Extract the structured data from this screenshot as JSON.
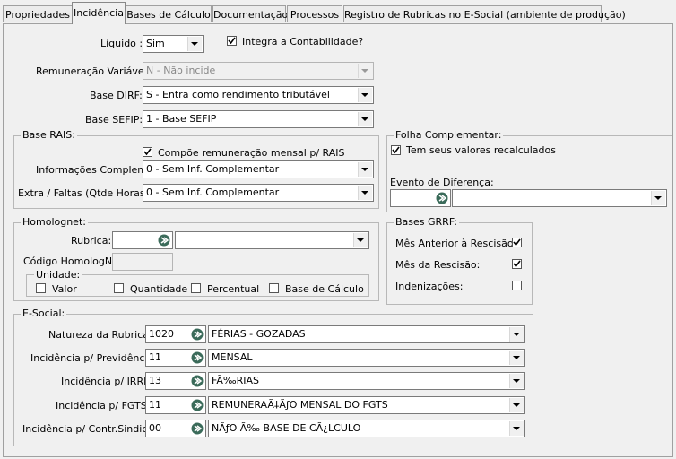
{
  "tabs": [
    "Propriedades",
    "Incidência",
    "Bases de Cálculo",
    "Documentação",
    "Processos",
    "Registro de Rubricas no E-Social (ambiente de produção)"
  ],
  "top": {
    "liquido_label": "Líquido :",
    "liquido_value": "Sim",
    "integra_label": "Integra a Contabilidade?",
    "remuneracao_label": "Remuneração Variável:",
    "remuneracao_value": "N - Não incide",
    "dirf_label": "Base DIRF:",
    "dirf_value": "S - Entra como rendimento tributável",
    "sefip_label": "Base SEFIP:",
    "sefip_value": "1 - Base SEFIP"
  },
  "rais": {
    "title": "Base RAIS:",
    "compoe_label": "Compõe remuneração mensal p/ RAIS",
    "info_label": "Informações Complem.:",
    "info_value": "0 - Sem Inf. Complementar",
    "extra_label": "Extra / Faltas (Qtde Horas):",
    "extra_value": "0 - Sem Inf. Complementar"
  },
  "folha": {
    "title": "Folha Complementar:",
    "recalc_label": "Tem seus valores recalculados",
    "evento_label": "Evento de Diferença:"
  },
  "homolognet": {
    "title": "Homolognet:",
    "rubrica_label": "Rubrica:",
    "codigo_label": "Código HomologNet",
    "unidade_title": "Unidade:",
    "valor_label": "Valor",
    "quantidade_label": "Quantidade",
    "percentual_label": "Percentual",
    "base_label": "Base de Cálculo"
  },
  "grrf": {
    "title": "Bases GRRF:",
    "mes_anterior_label": "Mês Anterior à Rescisão:",
    "mes_rescisao_label": "Mês da Rescisão:",
    "indenizacoes_label": "Indenizações:"
  },
  "esocial": {
    "title": "E-Social:",
    "rows": [
      {
        "label": "Natureza da Rubrica:",
        "code": "1020",
        "desc": "FÉRIAS - GOZADAS"
      },
      {
        "label": "Incidência p/ Previdência:",
        "code": "11",
        "desc": "MENSAL"
      },
      {
        "label": "Incidência p/ IRRF:",
        "code": "13",
        "desc": "FÃ‰RIAS"
      },
      {
        "label": "Incidência p/ FGTS:",
        "code": "11",
        "desc": "REMUNERAÃ‡ÃƒO MENSAL DO FGTS"
      },
      {
        "label": "Incidência p/ Contr.Sindical:",
        "code": "00",
        "desc": "NÃƒO Ã‰ BASE DE CÃ¿LCULO"
      }
    ]
  }
}
